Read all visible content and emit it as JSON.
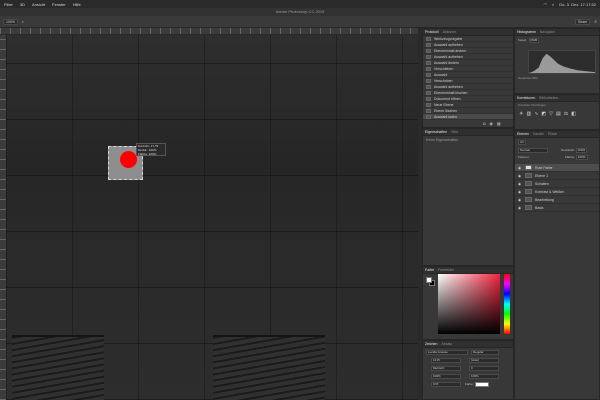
{
  "menubar": {
    "items": [
      "Filter",
      "3D",
      "Ansicht",
      "Fenster",
      "Hilfe"
    ],
    "clock": "Do. 3. Dez.  17:17:52"
  },
  "window": {
    "title": "Adobe Photoshop CC 2019"
  },
  "options": {
    "zoom": "100%",
    "share": "Share"
  },
  "canvas": {
    "tooltip": [
      "Kurzinfo: 17,79",
      "Deckk.: 100%",
      "Fläche: 100%"
    ]
  },
  "protokoll": {
    "tabs": [
      "Protokoll",
      "Aktionen"
    ],
    "items": [
      "Werkzeugvorgabe",
      "Auswahl aufheben",
      "Ebeneninhalt ändern",
      "Auswahl aufheben",
      "Auswahl ändern",
      "Verschieben",
      "Auswahl",
      "Verschoben",
      "Auswahl aufheben",
      "Ebeneninhalt löschen",
      "Dokument öffnen",
      "Neue Ebene",
      "Ebene löschen",
      "Auswahl laden"
    ]
  },
  "properties": {
    "tabs": [
      "Eigenschaften",
      "Sets"
    ],
    "empty": "Keine Eigenschaften"
  },
  "histogram": {
    "tabs": [
      "Histogramm",
      "Navigator"
    ],
    "channel_label": "Kanal:",
    "channel_value": "RGB",
    "source": "Gesamtes Bild"
  },
  "korrekturen": {
    "tabs": [
      "Korrekturen",
      "Bibliotheken"
    ],
    "hint": "Korrektur hinzufügen"
  },
  "layers": {
    "tabs": [
      "Ebenen",
      "Kanäle",
      "Pfade"
    ],
    "kind_label": "Art",
    "blend_mode": "Normal",
    "opacity_label": "Deckkraft:",
    "opacity": "100%",
    "lock_label": "Fixieren:",
    "fill_label": "Fläche:",
    "fill": "100%",
    "items": [
      "Rote Farbe",
      "Ebene 1",
      "Schatten",
      "Kontrast & Weißen",
      "Bearbeitung",
      "Basis"
    ]
  },
  "color": {
    "tabs": [
      "Farbe",
      "Farbfelder"
    ],
    "fg": "#ffffff",
    "hue_accent": "#f0243f"
  },
  "zeichen": {
    "tabs": [
      "Zeichen",
      "Absatz"
    ],
    "font": "Lucida Grande",
    "style": "Regular",
    "size": "12 Pt",
    "leading": "(Auto)",
    "tracking": "0",
    "kerning": "Metrisch",
    "scale_v": "100%",
    "scale_h": "100%",
    "baseline": "0 Pt",
    "color_label": "Farbe:"
  },
  "colors": {
    "red_dot": "#ff0000"
  }
}
